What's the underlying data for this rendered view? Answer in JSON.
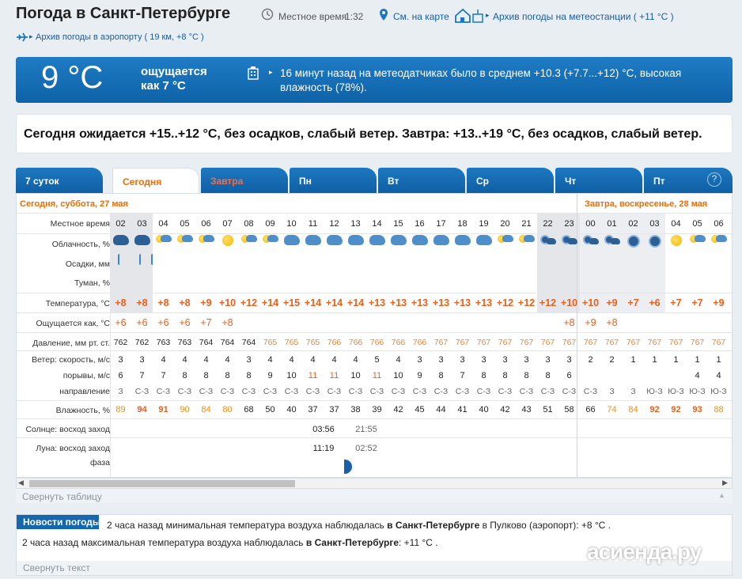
{
  "header": {
    "title": "Погода в Санкт-Петербурге",
    "local_time_label": "Местное время",
    "local_time": "1:32",
    "map_link": "См. на карте",
    "station_archive": "Архив погоды на метеостанции ( +11 °C )",
    "airport_archive": "Архив погоды в аэропорту ( 19 км, +8 °C )"
  },
  "now": {
    "temp": "9 °C",
    "feels_label": "ощущается",
    "feels_value": "как 7 °C",
    "station_text": "16 минут назад на метеодатчиках было в среднем +10.3 (+7.7...+12) °C, высокая влажность (78%)."
  },
  "forecast": "Сегодня ожидается +15..+12 °C, без осадков, слабый ветер. Завтра: +13..+19 °C, без осадков, слабый ветер.",
  "tabs": [
    "7 суток",
    "Сегодня",
    "Завтра",
    "Пн",
    "Вт",
    "Ср",
    "Чт",
    "Пт"
  ],
  "table": {
    "day1": "Сегодня, суббота, 27 мая",
    "day2": "Завтра, воскресенье, 28 мая",
    "labels": {
      "time": "Местное время",
      "cloud": "Облачность, %",
      "precip": "Осадки, мм",
      "fog": "Туман, %",
      "temp": "Температура, °C",
      "feels": "Ощущается как, °C",
      "pressure": "Давление, мм рт. ст.",
      "wind": "Ветер: скорость, м/с",
      "gusts": "порывы, м/с",
      "dir": "направление",
      "humidity": "Влажность, %",
      "sun": "Солнце: восход заход",
      "moon": "Луна: восход заход",
      "phase": "фаза"
    },
    "hours": [
      "02",
      "03",
      "04",
      "05",
      "06",
      "07",
      "08",
      "09",
      "10",
      "11",
      "12",
      "13",
      "14",
      "15",
      "16",
      "17",
      "18",
      "19",
      "20",
      "21",
      "22",
      "23",
      "00",
      "01",
      "02",
      "03",
      "04",
      "05",
      "06"
    ],
    "icons": [
      "night-cloud-rain",
      "night-cloud-rain",
      "sun-cloud",
      "sun-cloud",
      "sun-cloud",
      "sun",
      "sun-cloud",
      "sun-cloud",
      "cloud",
      "cloud",
      "cloud",
      "cloud",
      "cloud",
      "cloud",
      "cloud",
      "cloud",
      "cloud",
      "cloud",
      "sun-cloud",
      "sun-cloud",
      "night-cloud",
      "night-cloud",
      "night-cloud",
      "night-cloud",
      "night",
      "night",
      "sun",
      "sun-cloud",
      "sun-cloud"
    ],
    "temps": [
      "+8",
      "+8",
      "+8",
      "+8",
      "+9",
      "+10",
      "+12",
      "+14",
      "+15",
      "+14",
      "+14",
      "+14",
      "+13",
      "+13",
      "+13",
      "+13",
      "+13",
      "+13",
      "+12",
      "+12",
      "+12",
      "+10",
      "+10",
      "+9",
      "+7",
      "+6",
      "+7",
      "+7",
      "+9"
    ],
    "feels": [
      "+6",
      "+6",
      "+6",
      "+6",
      "+7",
      "+8",
      "",
      "",
      "",
      "",
      "",
      "",
      "",
      "",
      "",
      "",
      "",
      "",
      "",
      "",
      "",
      "+8",
      "+9",
      "+8",
      "",
      "",
      "",
      "",
      ""
    ],
    "pressure": [
      "762",
      "762",
      "763",
      "763",
      "764",
      "764",
      "764",
      "765",
      "765",
      "765",
      "766",
      "766",
      "766",
      "766",
      "766",
      "767",
      "767",
      "767",
      "767",
      "767",
      "767",
      "767",
      "767",
      "767",
      "767",
      "767",
      "767",
      "767",
      "767"
    ],
    "wind": [
      "3",
      "3",
      "4",
      "4",
      "4",
      "4",
      "3",
      "4",
      "4",
      "4",
      "4",
      "4",
      "5",
      "4",
      "3",
      "3",
      "3",
      "3",
      "3",
      "3",
      "3",
      "3",
      "2",
      "2",
      "1",
      "1",
      "1",
      "1",
      "1"
    ],
    "gusts": [
      "6",
      "7",
      "7",
      "8",
      "8",
      "8",
      "8",
      "9",
      "10",
      "11",
      "11",
      "10",
      "11",
      "10",
      "9",
      "8",
      "7",
      "8",
      "8",
      "8",
      "8",
      "6",
      "",
      "",
      "",
      "",
      "",
      "4",
      "4"
    ],
    "dirs": [
      "З",
      "С-З",
      "С-З",
      "С-З",
      "С-З",
      "С-З",
      "С-З",
      "С-З",
      "С-З",
      "С-З",
      "С-З",
      "С-З",
      "С-З",
      "С-З",
      "С-З",
      "С-З",
      "С-З",
      "С-З",
      "С-З",
      "С-З",
      "С-З",
      "С-З",
      "С-З",
      "З",
      "З",
      "Ю-З",
      "Ю-З",
      "Ю-З",
      "Ю-З"
    ],
    "humidity": [
      "89",
      "94",
      "91",
      "90",
      "84",
      "80",
      "68",
      "50",
      "40",
      "37",
      "37",
      "38",
      "39",
      "42",
      "45",
      "44",
      "41",
      "40",
      "42",
      "43",
      "51",
      "58",
      "66",
      "74",
      "84",
      "92",
      "92",
      "93",
      "88"
    ],
    "sunrise": "03:56",
    "sunset": "21:55",
    "moonrise": "11:19",
    "moonset": "02:52"
  },
  "collapse_table": "Свернуть таблицу",
  "news": {
    "badge": "Новости погоды",
    "line1_pre": "2 часа назад минимальная температура воздуха наблюдалась ",
    "line1_city": "в Санкт-Петербурге",
    "line1_post": " в Пулково (аэропорт): +8 °C .",
    "line2_pre": "2 часа назад максимальная температура воздуха наблюдалась ",
    "line2_city": "в Санкт-Петербурге",
    "line2_post": ": +11 °C .",
    "collapse": "Свернуть текст"
  },
  "watermark": "асиенда.ру"
}
